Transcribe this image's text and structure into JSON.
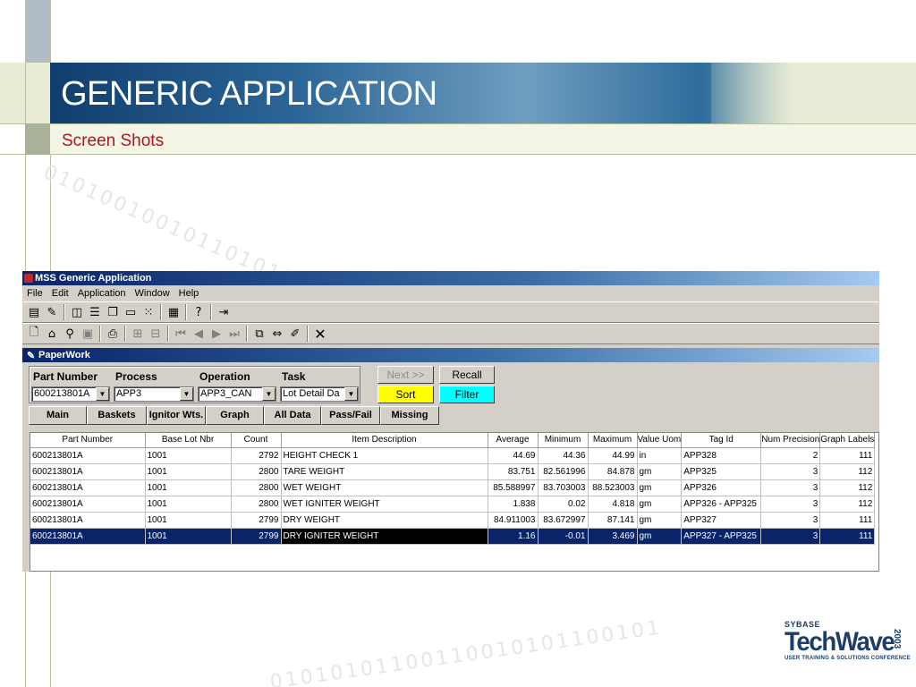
{
  "slide": {
    "title": "GENERIC APPLICATION",
    "subtitle": "Screen Shots",
    "logo": {
      "brand": "SYBASE",
      "name": "TechWave",
      "year": "2003",
      "tagline": "USER TRAINING & SOLUTIONS CONFERENCE"
    }
  },
  "app": {
    "title": "MSS Generic Application",
    "menu": [
      "File",
      "Edit",
      "Application",
      "Window",
      "Help"
    ],
    "toolbar1": [
      "properties-icon",
      "brush-icon",
      "tile-vertical-icon",
      "tile-horizontal-icon",
      "cascade-icon",
      "window-icon",
      "arrange-icons-icon",
      "grid-icon",
      "help-icon",
      "exit-icon"
    ],
    "toolbar2": [
      "new-icon",
      "open-icon",
      "retrieve-icon",
      "save-icon",
      "print-icon",
      "insert-row-icon",
      "delete-row-icon",
      "first-icon",
      "prior-icon",
      "next-icon",
      "last-icon",
      "copy-icon",
      "compare-icon",
      "clear-icon",
      "close-icon"
    ],
    "child_title": "PaperWork",
    "filters": {
      "part_number_label": "Part Number",
      "process_label": "Process",
      "operation_label": "Operation",
      "task_label": "Task",
      "part_number_value": "600213801A",
      "process_value": "APP3",
      "operation_value": "APP3_CAN",
      "task_value": "Lot Detail Da"
    },
    "buttons": {
      "next": "Next >>",
      "recall": "Recall",
      "sort": "Sort",
      "filter": "Filter"
    },
    "tabs": [
      "Main",
      "Baskets",
      "Ignitor Wts.",
      "Graph",
      "All Data",
      "Pass/Fail",
      "Missing"
    ],
    "grid": {
      "columns": [
        "Part Number",
        "Base Lot Nbr",
        "Count",
        "Item Description",
        "Average",
        "Minimum",
        "Maximum",
        "Value Uom",
        "Tag Id",
        "Num Precision",
        "Graph Labels"
      ],
      "rows": [
        [
          "600213801A",
          "1001",
          "2792",
          "HEIGHT CHECK 1",
          "44.69",
          "44.36",
          "44.99",
          "in",
          "APP328",
          "2",
          "111"
        ],
        [
          "600213801A",
          "1001",
          "2800",
          "TARE WEIGHT",
          "83.751",
          "82.561996",
          "84.878",
          "gm",
          "APP325",
          "3",
          "112"
        ],
        [
          "600213801A",
          "1001",
          "2800",
          "WET WEIGHT",
          "85.588997",
          "83.703003",
          "88.523003",
          "gm",
          "APP326",
          "3",
          "112"
        ],
        [
          "600213801A",
          "1001",
          "2800",
          "WET IGNITER WEIGHT",
          "1.838",
          "0.02",
          "4.818",
          "gm",
          "APP326 - APP325",
          "3",
          "112"
        ],
        [
          "600213801A",
          "1001",
          "2799",
          "DRY WEIGHT",
          "84.911003",
          "83.672997",
          "87.141",
          "gm",
          "APP327",
          "3",
          "111"
        ],
        [
          "600213801A",
          "1001",
          "2799",
          "DRY IGNITER WEIGHT",
          "1.16",
          "-0.01",
          "3.469",
          "gm",
          "APP327 - APP325",
          "3",
          "111"
        ]
      ],
      "selected_row": 5
    }
  }
}
